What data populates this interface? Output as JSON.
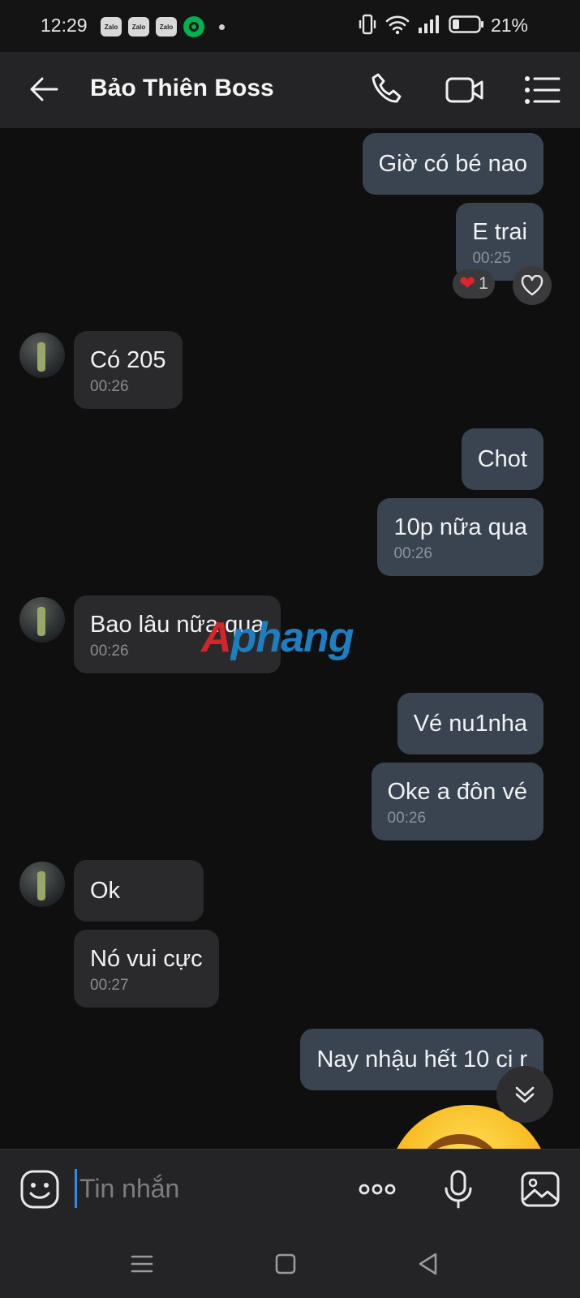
{
  "status_bar": {
    "time": "12:29",
    "app_icons": [
      "Zalo",
      "Zalo",
      "Zalo",
      "grab-icon"
    ],
    "battery": "21%"
  },
  "header": {
    "title": "Bảo Thiên Boss",
    "icons": [
      "back-arrow-icon",
      "phone-icon",
      "video-camera-icon",
      "menu-list-icon"
    ]
  },
  "messages": [
    {
      "direction": "out",
      "text": "Giờ có bé nao",
      "time": ""
    },
    {
      "direction": "out",
      "text": "E trai",
      "time": "00:25",
      "reaction": {
        "emoji": "❤",
        "count": "1"
      }
    },
    {
      "direction": "in",
      "text": "Có 205",
      "time": "00:26"
    },
    {
      "direction": "out",
      "text": "Chot",
      "time": ""
    },
    {
      "direction": "out",
      "text": "10p nữa qua",
      "time": "00:26"
    },
    {
      "direction": "in",
      "text": "Bao lâu nữa qua",
      "time": "00:26"
    },
    {
      "direction": "out",
      "text": "Vé nu1nha",
      "time": ""
    },
    {
      "direction": "out",
      "text": "Oke a đôn vé",
      "time": "00:26"
    },
    {
      "direction": "in",
      "text": "Ok",
      "time": ""
    },
    {
      "direction": "in",
      "text": "Nó vui cực",
      "time": "00:27"
    },
    {
      "direction": "out",
      "text": "Nay nhậu hết 10 ci r",
      "time": ""
    }
  ],
  "watermark": {
    "part1": "A",
    "part2": "phang"
  },
  "input": {
    "placeholder": "Tin nhắn"
  },
  "colors": {
    "outgoing_bubble": "#3a4450",
    "incoming_bubble": "#2a2a2c",
    "caret": "#2d8ee8",
    "heart": "#e0242e"
  }
}
